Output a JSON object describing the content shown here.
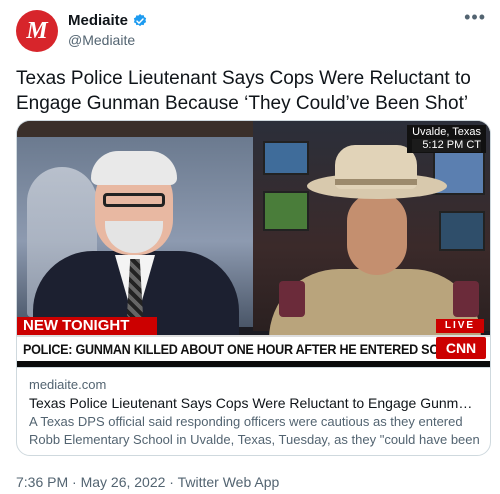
{
  "tweet": {
    "display_name": "Mediaite",
    "handle": "@Mediaite",
    "avatar_letter": "M",
    "more_icon": "•••",
    "text": "Texas Police Lieutenant Says Cops Were Reluctant to Engage Gunman Because ‘They Could’ve Been Shot’",
    "timestamp": "7:36 PM · May 26, 2022 · Twitter Web App"
  },
  "card": {
    "domain": "mediaite.com",
    "title": "Texas Police Lieutenant Says Cops Were Reluctant to Engage Gunman Becaus…",
    "description": "A Texas DPS official said responding officers were cautious as they entered Robb Elementary School in Uvalde, Texas, Tuesday, as they \"could have been …"
  },
  "media": {
    "location": "Uvalde, Texas",
    "time": "5:12 PM CT",
    "new_tonight": "NEW TONIGHT",
    "headline": "POLICE: GUNMAN KILLED ABOUT ONE HOUR AFTER HE ENTERED SCHOOL",
    "live": "LIVE",
    "network": "CNN"
  },
  "colors": {
    "brand_red": "#d7252b",
    "verified_blue": "#1d9bf0",
    "secondary_text": "#536471"
  }
}
